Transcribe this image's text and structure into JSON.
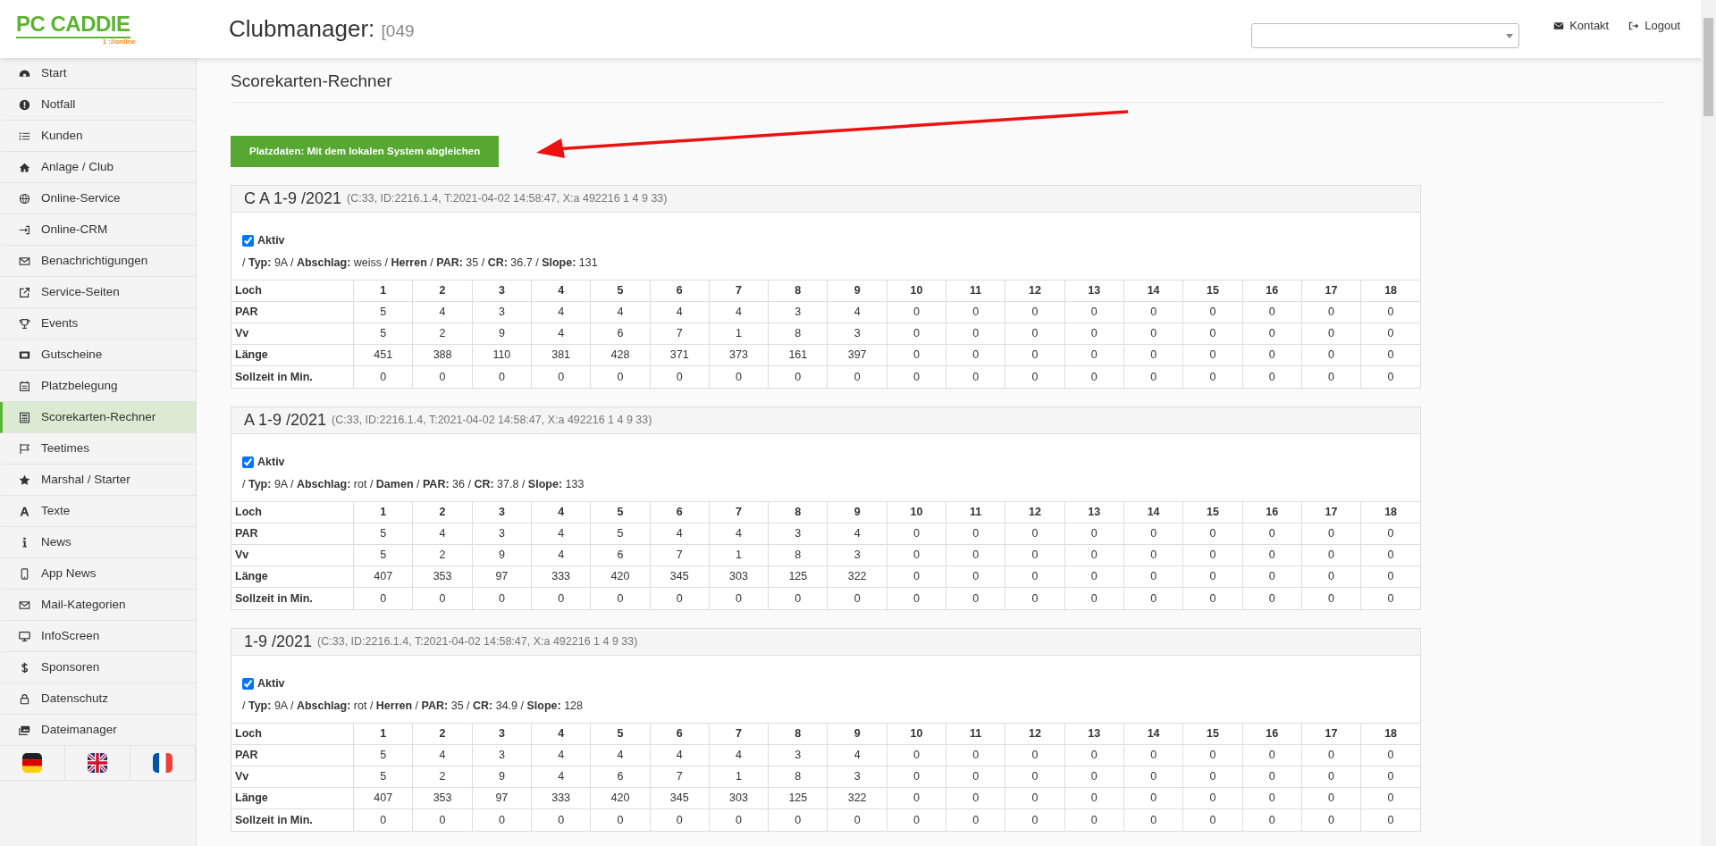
{
  "header": {
    "logo": {
      "text": "PC CADDIE",
      "sub": "1 ://online"
    },
    "title": "Clubmanager:",
    "title_code": "[049",
    "links": [
      {
        "label": "Kontakt",
        "kind": "mail"
      },
      {
        "label": "Logout",
        "kind": "logout"
      }
    ]
  },
  "sidebar": {
    "items": [
      {
        "label": "Start",
        "kind": "dashboard",
        "selected": false
      },
      {
        "label": "Notfall",
        "kind": "alert",
        "selected": false
      },
      {
        "label": "Kunden",
        "kind": "list",
        "selected": false
      },
      {
        "label": "Anlage / Club",
        "kind": "home",
        "selected": false
      },
      {
        "label": "Online-Service",
        "kind": "globe",
        "selected": false
      },
      {
        "label": "Online-CRM",
        "kind": "signin",
        "selected": false
      },
      {
        "label": "Benachrichtigungen",
        "kind": "mail",
        "selected": false
      },
      {
        "label": "Service-Seiten",
        "kind": "external",
        "selected": false
      },
      {
        "label": "Events",
        "kind": "trophy",
        "selected": false
      },
      {
        "label": "Gutscheine",
        "kind": "ticket",
        "selected": false
      },
      {
        "label": "Platzbelegung",
        "kind": "calendar",
        "selected": false
      },
      {
        "label": "Scorekarten-Rechner",
        "kind": "calculator",
        "selected": true
      },
      {
        "label": "Teetimes",
        "kind": "flag",
        "selected": false
      },
      {
        "label": "Marshal / Starter",
        "kind": "star",
        "selected": false
      },
      {
        "label": "Texte",
        "kind": "font",
        "selected": false
      },
      {
        "label": "News",
        "kind": "info",
        "selected": false
      },
      {
        "label": "App News",
        "kind": "phone",
        "selected": false
      },
      {
        "label": "Mail-Kategorien",
        "kind": "mail",
        "selected": false
      },
      {
        "label": "InfoScreen",
        "kind": "monitor",
        "selected": false
      },
      {
        "label": "Sponsoren",
        "kind": "dollar",
        "selected": false
      },
      {
        "label": "Datenschutz",
        "kind": "lock",
        "selected": false
      },
      {
        "label": "Dateimanager",
        "kind": "images",
        "selected": false
      }
    ],
    "languages": [
      {
        "kind": "de"
      },
      {
        "kind": "en"
      },
      {
        "kind": "fr"
      }
    ]
  },
  "page": {
    "title": "Scorekarten-Rechner",
    "sync_button": "Platzdaten: Mit dem lokalen System abgleichen",
    "cards": [
      {
        "title": "C A 1-9 /2021",
        "meta": "(C:33, ID:2216.1.4, T:2021-04-02 14:58:47, X:a 492216 1 4 9 33)",
        "active": true,
        "active_label": "Aktiv",
        "info": "/ **Typ:** 9A / **Abschlag:** weiss / **Herren** / **PAR:** 35 / **CR:** 36.7 / **Slope:** 131",
        "rows": [
          {
            "kind": "header",
            "cells": [
              "Loch",
              "1",
              "2",
              "3",
              "4",
              "5",
              "6",
              "7",
              "8",
              "9",
              "10",
              "11",
              "12",
              "13",
              "14",
              "15",
              "16",
              "17",
              "18"
            ]
          },
          {
            "kind": "data",
            "cells": [
              "PAR",
              "5",
              "4",
              "3",
              "4",
              "4",
              "4",
              "4",
              "3",
              "4",
              "0",
              "0",
              "0",
              "0",
              "0",
              "0",
              "0",
              "0",
              "0"
            ]
          },
          {
            "kind": "data",
            "cells": [
              "Vv",
              "5",
              "2",
              "9",
              "4",
              "6",
              "7",
              "1",
              "8",
              "3",
              "0",
              "0",
              "0",
              "0",
              "0",
              "0",
              "0",
              "0",
              "0"
            ]
          },
          {
            "kind": "data",
            "cells": [
              "Länge",
              "451",
              "388",
              "110",
              "381",
              "428",
              "371",
              "373",
              "161",
              "397",
              "0",
              "0",
              "0",
              "0",
              "0",
              "0",
              "0",
              "0",
              "0"
            ]
          },
          {
            "kind": "data",
            "cells": [
              "Sollzeit in Min.",
              "0",
              "0",
              "0",
              "0",
              "0",
              "0",
              "0",
              "0",
              "0",
              "0",
              "0",
              "0",
              "0",
              "0",
              "0",
              "0",
              "0",
              "0"
            ]
          }
        ]
      },
      {
        "title": "A 1-9 /2021",
        "meta": "(C:33, ID:2216.1.4, T:2021-04-02 14:58:47, X:a 492216 1 4 9 33)",
        "active": true,
        "active_label": "Aktiv",
        "info": "/ **Typ:** 9A / **Abschlag:** rot / **Damen** / **PAR:** 36 / **CR:** 37.8 / **Slope:** 133",
        "rows": [
          {
            "kind": "header",
            "cells": [
              "Loch",
              "1",
              "2",
              "3",
              "4",
              "5",
              "6",
              "7",
              "8",
              "9",
              "10",
              "11",
              "12",
              "13",
              "14",
              "15",
              "16",
              "17",
              "18"
            ]
          },
          {
            "kind": "data",
            "cells": [
              "PAR",
              "5",
              "4",
              "3",
              "4",
              "5",
              "4",
              "4",
              "3",
              "4",
              "0",
              "0",
              "0",
              "0",
              "0",
              "0",
              "0",
              "0",
              "0"
            ]
          },
          {
            "kind": "data",
            "cells": [
              "Vv",
              "5",
              "2",
              "9",
              "4",
              "6",
              "7",
              "1",
              "8",
              "3",
              "0",
              "0",
              "0",
              "0",
              "0",
              "0",
              "0",
              "0",
              "0"
            ]
          },
          {
            "kind": "data",
            "cells": [
              "Länge",
              "407",
              "353",
              "97",
              "333",
              "420",
              "345",
              "303",
              "125",
              "322",
              "0",
              "0",
              "0",
              "0",
              "0",
              "0",
              "0",
              "0",
              "0"
            ]
          },
          {
            "kind": "data",
            "cells": [
              "Sollzeit in Min.",
              "0",
              "0",
              "0",
              "0",
              "0",
              "0",
              "0",
              "0",
              "0",
              "0",
              "0",
              "0",
              "0",
              "0",
              "0",
              "0",
              "0",
              "0"
            ]
          }
        ]
      },
      {
        "title": "1-9 /2021",
        "meta": "(C:33, ID:2216.1.4, T:2021-04-02 14:58:47, X:a 492216 1 4 9 33)",
        "active": true,
        "active_label": "Aktiv",
        "info": "/ **Typ:** 9A / **Abschlag:** rot / **Herren** / **PAR:** 35 / **CR:** 34.9 / **Slope:** 128",
        "rows": [
          {
            "kind": "header",
            "cells": [
              "Loch",
              "1",
              "2",
              "3",
              "4",
              "5",
              "6",
              "7",
              "8",
              "9",
              "10",
              "11",
              "12",
              "13",
              "14",
              "15",
              "16",
              "17",
              "18"
            ]
          },
          {
            "kind": "data",
            "cells": [
              "PAR",
              "5",
              "4",
              "3",
              "4",
              "4",
              "4",
              "4",
              "3",
              "4",
              "0",
              "0",
              "0",
              "0",
              "0",
              "0",
              "0",
              "0",
              "0"
            ]
          },
          {
            "kind": "data",
            "cells": [
              "Vv",
              "5",
              "2",
              "9",
              "4",
              "6",
              "7",
              "1",
              "8",
              "3",
              "0",
              "0",
              "0",
              "0",
              "0",
              "0",
              "0",
              "0",
              "0"
            ]
          },
          {
            "kind": "data",
            "cells": [
              "Länge",
              "407",
              "353",
              "97",
              "333",
              "420",
              "345",
              "303",
              "125",
              "322",
              "0",
              "0",
              "0",
              "0",
              "0",
              "0",
              "0",
              "0",
              "0"
            ]
          },
          {
            "kind": "data",
            "cells": [
              "Sollzeit in Min.",
              "0",
              "0",
              "0",
              "0",
              "0",
              "0",
              "0",
              "0",
              "0",
              "0",
              "0",
              "0",
              "0",
              "0",
              "0",
              "0",
              "0",
              "0"
            ]
          }
        ]
      }
    ]
  }
}
